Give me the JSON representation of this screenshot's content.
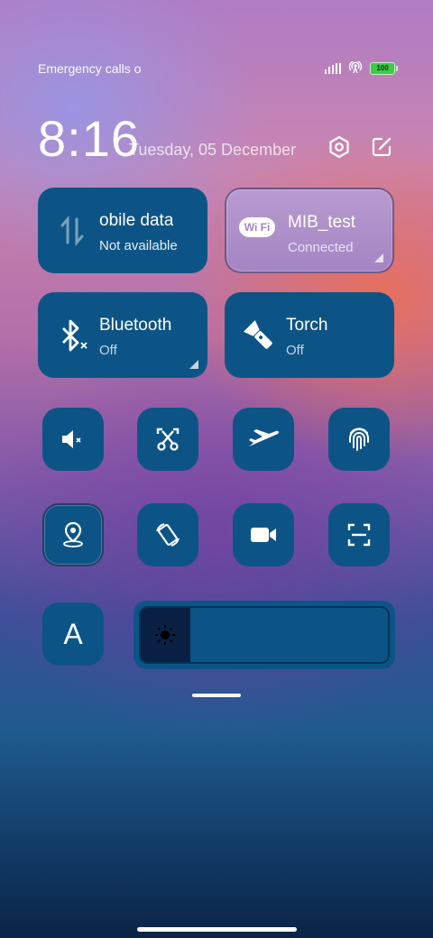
{
  "status_bar": {
    "carrier_text": "Emergency calls o",
    "battery": "100"
  },
  "header": {
    "time": "8:16",
    "date": "Tuesday, 05 December"
  },
  "tiles": {
    "mobile_data": {
      "label": "obile data",
      "status": "Not available"
    },
    "wifi": {
      "label": "MIB_test",
      "status": "Connected",
      "badge": "Wi Fi"
    },
    "bluetooth": {
      "label": "Bluetooth",
      "status": "Off"
    },
    "torch": {
      "label": "Torch",
      "status": "Off"
    }
  },
  "toggles": {
    "row1": [
      "mute-icon",
      "screenshot-icon",
      "airplane-icon",
      "fingerprint-icon"
    ],
    "row2": [
      "location-icon",
      "auto-rotate-icon",
      "video-camera-icon",
      "scan-icon"
    ]
  },
  "font_tile": {
    "label": "A"
  },
  "brightness": {
    "level": 0.2
  },
  "colors": {
    "tile": "#0d5486",
    "active_tile": "#a485c3"
  }
}
